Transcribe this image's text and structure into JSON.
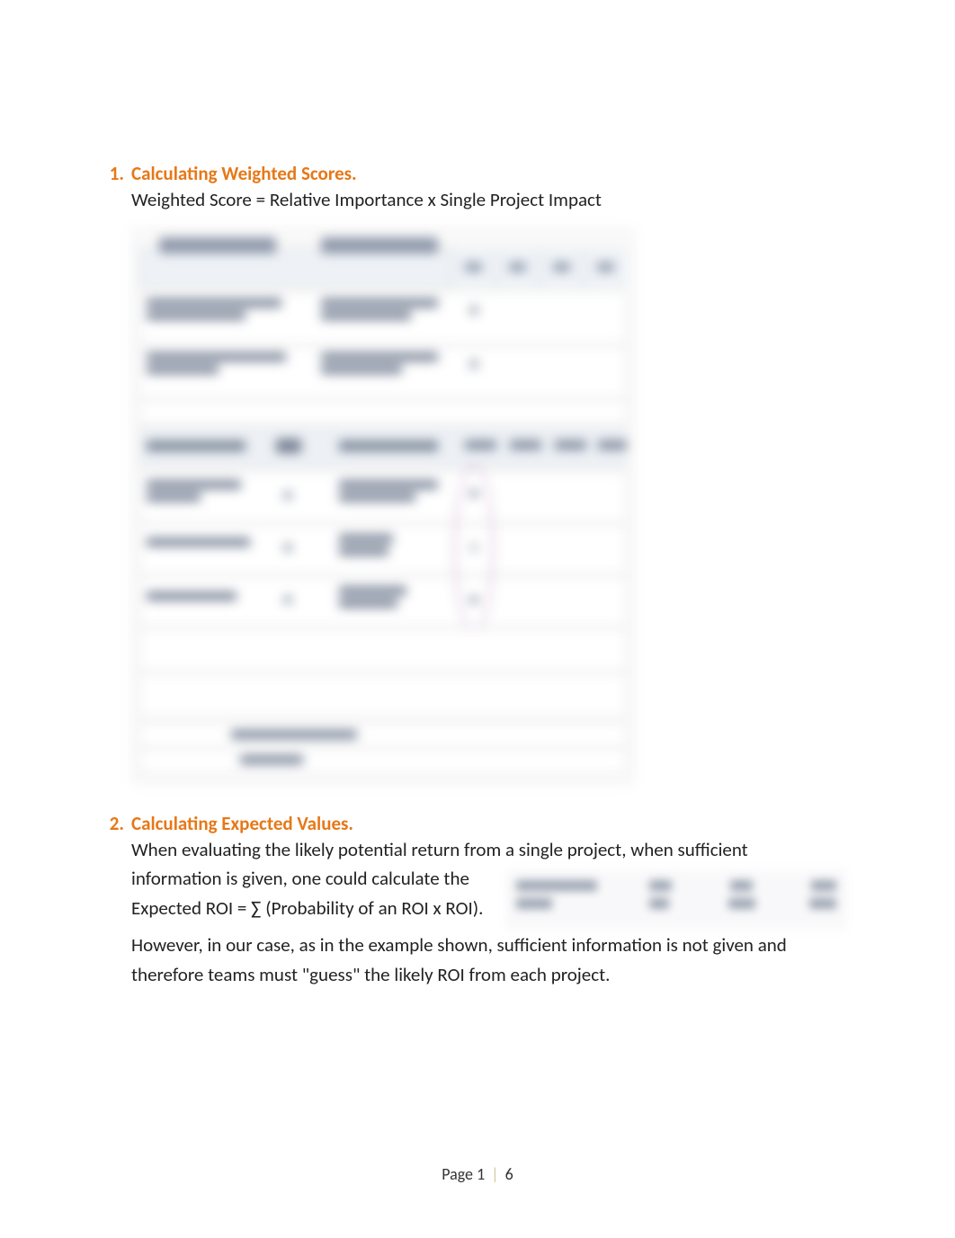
{
  "section1": {
    "number": "1.",
    "title": "Calculating Weighted Scores.",
    "body": "Weighted Score = Relative Importance x Single Project Impact"
  },
  "section2": {
    "number": "2.",
    "title": "Calculating Expected Values.",
    "body_part1": "When evaluating the likely potential return from a single project, when sufficient",
    "body_part2_left": "information is given, one could calculate the Expected ROI = ∑ (Probability of an ROI x ROI).",
    "body_part3": "However, in our case, as in the example shown, sufficient information is not given and therefore teams must \"guess\" the likely ROI from each project."
  },
  "footer": {
    "page_label": "Page",
    "current": "1",
    "total": "6"
  }
}
